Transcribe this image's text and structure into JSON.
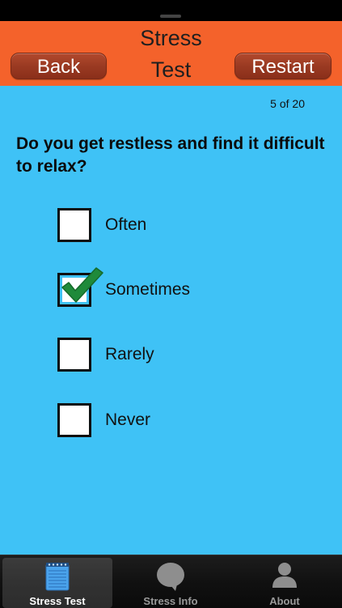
{
  "nav": {
    "title": "Stress\nTest",
    "back_label": "Back",
    "restart_label": "Restart"
  },
  "progress": "5 of 20",
  "question": "Do you get restless and find it difficult to relax?",
  "options": [
    {
      "label": "Often",
      "checked": false
    },
    {
      "label": "Sometimes",
      "checked": true
    },
    {
      "label": "Rarely",
      "checked": false
    },
    {
      "label": "Never",
      "checked": false
    }
  ],
  "tabs": [
    {
      "label": "Stress Test",
      "icon": "notepad-icon",
      "active": true
    },
    {
      "label": "Stress Info",
      "icon": "speech-bubble-icon",
      "active": false
    },
    {
      "label": "About",
      "icon": "person-icon",
      "active": false
    }
  ],
  "colors": {
    "nav_bar": "#f4622b",
    "background": "#3fc2f6",
    "checkmark": "#1f8a3a"
  }
}
